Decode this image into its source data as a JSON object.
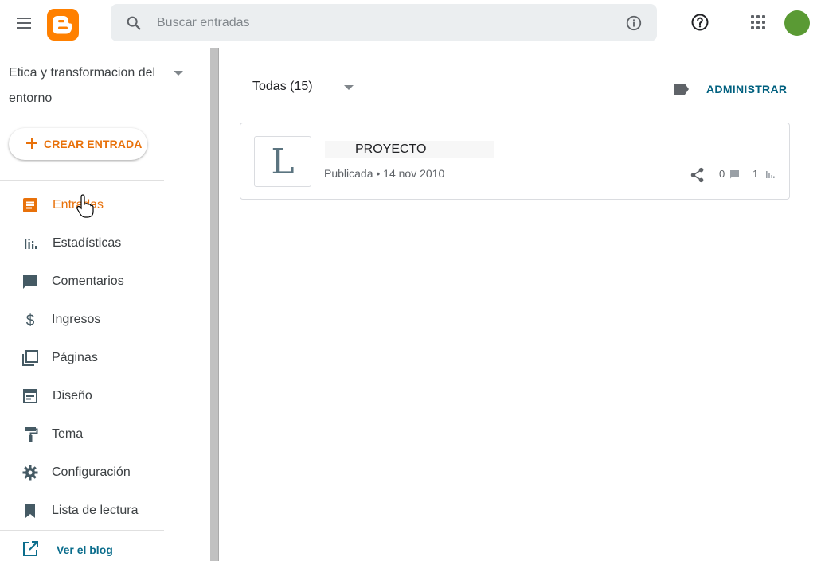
{
  "app": {
    "brand": "Blogger",
    "accent": "#e8710a",
    "logo_color": "#ff8000",
    "link_color": "#00607f"
  },
  "header": {
    "menu_icon": "hamburger-icon",
    "search": {
      "placeholder": "Buscar entradas",
      "value": ""
    },
    "info_icon": "info-icon",
    "help_icon": "help-icon",
    "apps_icon": "apps-grid-icon",
    "avatar_color": "#5a9a34"
  },
  "sidebar": {
    "blog_title": "Etica y transformacion del entorno",
    "create_label": "CREAR ENTRADA",
    "items": [
      {
        "label": "Entradas",
        "icon": "posts-icon",
        "active": true
      },
      {
        "label": "Estadísticas",
        "icon": "stats-icon"
      },
      {
        "label": "Comentarios",
        "icon": "comment-icon"
      },
      {
        "label": "Ingresos",
        "icon": "dollar-icon"
      },
      {
        "label": "Páginas",
        "icon": "pages-icon"
      },
      {
        "label": "Diseño",
        "icon": "layout-icon"
      },
      {
        "label": "Tema",
        "icon": "paint-roller-icon"
      },
      {
        "label": "Configuración",
        "icon": "gear-icon"
      },
      {
        "label": "Lista de lectura",
        "icon": "bookmark-icon"
      }
    ],
    "view_blog": "Ver el blog"
  },
  "main": {
    "filter_label": "Todas (15)",
    "manage_label": "ADMINISTRAR",
    "posts": [
      {
        "thumb_letter": "L",
        "title": "PROYECTO",
        "meta": "Publicada • 14 nov 2010",
        "comments": "0",
        "views": "1"
      }
    ]
  }
}
